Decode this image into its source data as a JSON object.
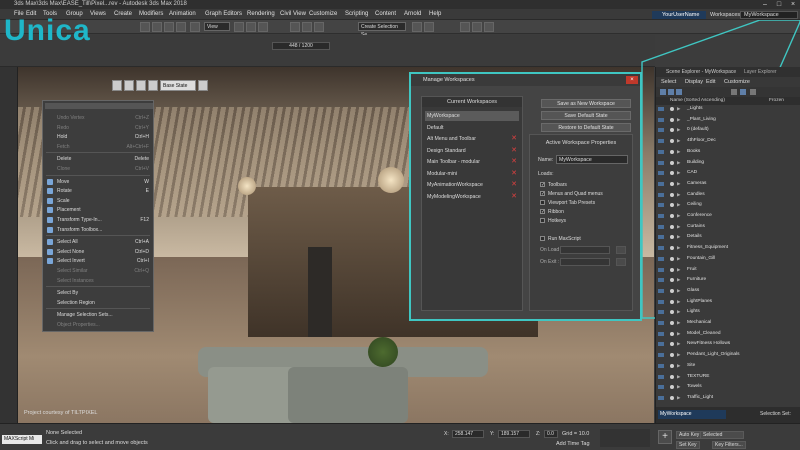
{
  "window": {
    "title": "3ds Max\\3ds Max\\EASE_Till\\Pixel...rev - Autodesk 3ds Max 2018"
  },
  "logo": {
    "text": "Unica"
  },
  "menu": [
    "File",
    "Edit",
    "Tools",
    "Group",
    "Views",
    "Create",
    "Modifiers",
    "Animation",
    "Graph Editors",
    "Rendering",
    "Civil View",
    "Customize",
    "Scripting",
    "Content",
    "Arnold",
    "Help"
  ],
  "user": {
    "name": "YourUserName",
    "workspaces_label": "Workspaces:",
    "workspace": "MyWorkspace"
  },
  "toolbar": {
    "view_select": "View",
    "create_selection_set": "Create Selection Se"
  },
  "timeline": {
    "frames": "448 / 1200"
  },
  "viewport": {
    "base_state": "Base State",
    "courtesy": "Project courtesy of TILTPIXEL"
  },
  "quad_menu": {
    "items": [
      {
        "label": "Undo Vertex",
        "key": "Ctrl+Z",
        "dim": true
      },
      {
        "label": "Redo",
        "key": "Ctrl+Y",
        "dim": true
      },
      {
        "label": "Hold",
        "key": "Ctrl+H",
        "dim": false
      },
      {
        "label": "Fetch",
        "key": "Alt+Ctrl+F",
        "dim": true
      },
      {
        "label": "Delete",
        "key": "Delete",
        "dim": false
      },
      {
        "label": "Clone",
        "key": "Ctrl+V",
        "dim": true
      },
      {
        "label": "Move",
        "key": "W",
        "dim": false
      },
      {
        "label": "Rotate",
        "key": "E",
        "dim": false
      },
      {
        "label": "Scale",
        "key": "",
        "dim": false
      },
      {
        "label": "Placement",
        "key": "",
        "dim": false
      },
      {
        "label": "Transform Type-In...",
        "key": "F12",
        "dim": false
      },
      {
        "label": "Transform Toolbox...",
        "key": "",
        "dim": false
      },
      {
        "label": "Select All",
        "key": "Ctrl+A",
        "dim": false
      },
      {
        "label": "Select None",
        "key": "Ctrl+D",
        "dim": false
      },
      {
        "label": "Select Invert",
        "key": "Ctrl+I",
        "dim": false
      },
      {
        "label": "Select Similar",
        "key": "Ctrl+Q",
        "dim": true
      },
      {
        "label": "Select Instances",
        "key": "",
        "dim": true
      },
      {
        "label": "Select By",
        "key": "",
        "dim": false
      },
      {
        "label": "Selection Region",
        "key": "",
        "dim": false
      },
      {
        "label": "Manage Selection Sets...",
        "key": "",
        "dim": false
      },
      {
        "label": "Object Properties...",
        "key": "",
        "dim": true
      }
    ]
  },
  "dialog": {
    "title": "Manage Workspaces",
    "current_header": "Current Workspaces",
    "workspaces": [
      {
        "name": "MyWorkspace",
        "deletable": false,
        "selected": true
      },
      {
        "name": "Default",
        "deletable": false,
        "selected": false
      },
      {
        "name": "Alt Menu and Toolbar",
        "deletable": true,
        "selected": false
      },
      {
        "name": "Design Standard",
        "deletable": true,
        "selected": false
      },
      {
        "name": "Main Toolbar - modular",
        "deletable": true,
        "selected": false
      },
      {
        "name": "Modular-mini",
        "deletable": true,
        "selected": false
      },
      {
        "name": "MyAnimationWorkspace",
        "deletable": true,
        "selected": false
      },
      {
        "name": "MyModelingWorkspace",
        "deletable": true,
        "selected": false
      }
    ],
    "buttons": {
      "save_new": "Save as New Workspace",
      "save_default": "Save Default State",
      "restore_default": "Restore to Default State"
    },
    "active_header": "Active Workspace Properties",
    "name_label": "Name:",
    "name_value": "MyWorkspace",
    "loads_label": "Loads:",
    "loads": [
      {
        "label": "Toolbars",
        "checked": true
      },
      {
        "label": "Menus and Quad menus",
        "checked": true
      },
      {
        "label": "Viewport Tab Presets",
        "checked": false
      },
      {
        "label": "Ribbon",
        "checked": true
      },
      {
        "label": "Hotkeys",
        "checked": false
      }
    ],
    "run_maxscript": "Run MaxScript",
    "on_load": "On Load :",
    "on_exit": "On Exit :"
  },
  "scene_explorer": {
    "title": "Scene Explorer - MyWorkspace",
    "layer_explorer": "Layer Explorer",
    "tabs": [
      "Select",
      "Display",
      "Edit",
      "Customize"
    ],
    "col_name": "Name (Sorted Ascending)",
    "col_other": "Frozen",
    "rows": [
      "_Lights",
      "_Plant_Living",
      "0 (default)",
      "4thFloor_Dec",
      "Books",
      "Building",
      "CAD",
      "Cameras",
      "Candles",
      "Ceiling",
      "Conference",
      "Curtains",
      "Details",
      "Fitness_Equipment",
      "Fountain_Gill",
      "Fruit",
      "Furniture",
      "Glass",
      "LightPlanes",
      "Lights",
      "Mechanical",
      "Model_Cleaned",
      "NewFitness Hollows",
      "Pendant_Light_Originals",
      "Site",
      "TEXTURE",
      "Towels",
      "Traffic_Light"
    ],
    "workspace_field": "MyWorkspace",
    "selection_set": "Selection Set:"
  },
  "status": {
    "maxscript": "MAXScript Mi",
    "none_selected": "None Selected",
    "hint": "Click and drag to select and move objects",
    "x_label": "X:",
    "x_value": "258.147",
    "y_label": "Y:",
    "y_value": "189.157",
    "z_label": "Z:",
    "z_value": "0.0",
    "grid": "Grid = 10.0",
    "add_time_tag": "Add Time Tag",
    "auto_key": "Auto Key",
    "selected": "Selected",
    "set_key": "Set Key",
    "key_filters": "Key Filters..."
  },
  "colors": {
    "accent": "#3fc6c2",
    "delete_x": "#e04040",
    "user_bg": "#1f3a5a"
  }
}
